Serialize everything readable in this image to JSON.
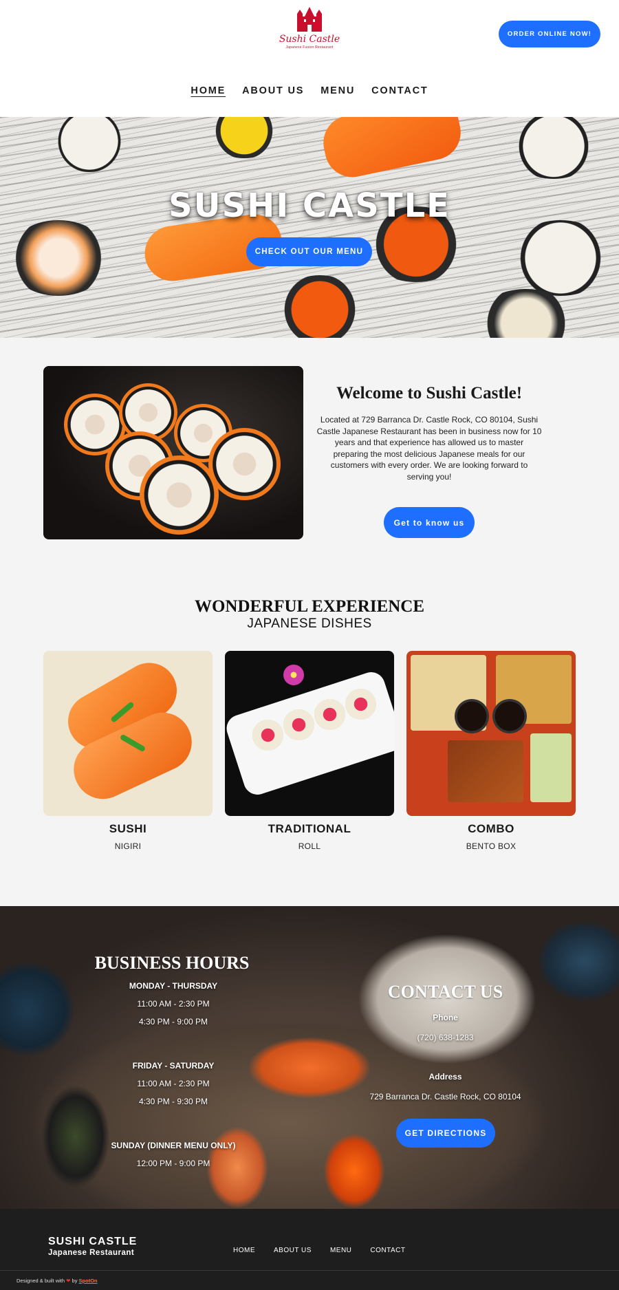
{
  "header": {
    "logo_name": "Sushi Castle",
    "logo_tagline": "Japanese Fusion Restaurant",
    "order_button": "ORDER ONLINE NOW!",
    "nav": [
      "HOME",
      "ABOUT US",
      "MENU",
      "CONTACT"
    ],
    "active_nav": "HOME"
  },
  "hero": {
    "title": "SUSHI CASTLE",
    "button": "CHECK OUT OUR MENU"
  },
  "welcome": {
    "title": "Welcome to Sushi Castle!",
    "text": "Located at 729 Barranca Dr. Castle Rock, CO 80104, Sushi Castle Japanese Restaurant has been in business now for 10 years and that experience has allowed us to master preparing the most delicious Japanese meals for our customers with every order. We are looking forward to serving you!",
    "button": "Get to know us"
  },
  "dishes": {
    "title": "WONDERFUL EXPERIENCE",
    "subtitle": "JAPANESE DISHES",
    "items": [
      {
        "name": "SUSHI",
        "desc": "NIGIRI"
      },
      {
        "name": "TRADITIONAL",
        "desc": "ROLL"
      },
      {
        "name": "COMBO",
        "desc": "BENTO BOX"
      }
    ]
  },
  "hours": {
    "title": "BUSINESS HOURS",
    "blocks": [
      {
        "day": "MONDAY - THURSDAY",
        "times": [
          "11:00 AM - 2:30 PM",
          "4:30 PM - 9:00 PM"
        ]
      },
      {
        "day": "FRIDAY - SATURDAY",
        "times": [
          "11:00 AM - 2:30 PM",
          "4:30 PM - 9:30 PM"
        ]
      },
      {
        "day": "SUNDAY (DINNER MENU ONLY)",
        "times": [
          "12:00 PM - 9:00 PM"
        ]
      }
    ]
  },
  "contact": {
    "title": "CONTACT US",
    "phone_label": "Phone",
    "phone": "(720) 638-1283",
    "address_label": "Address",
    "address": "729 Barranca Dr. Castle Rock, CO 80104",
    "button": "GET DIRECTIONS"
  },
  "footer": {
    "brand": "SUSHI CASTLE",
    "brand_sub": "Japanese Restaurant",
    "nav": [
      "HOME",
      "ABOUT US",
      "MENU",
      "CONTACT"
    ],
    "credit_prefix": "Designed & built with",
    "credit_by": "by",
    "credit_brand": "SpotOn"
  },
  "colors": {
    "accent": "#1e6fff",
    "logo_red": "#c8102e",
    "footer_bg": "#1e1e1e",
    "page_bg": "#f4f4f4"
  }
}
